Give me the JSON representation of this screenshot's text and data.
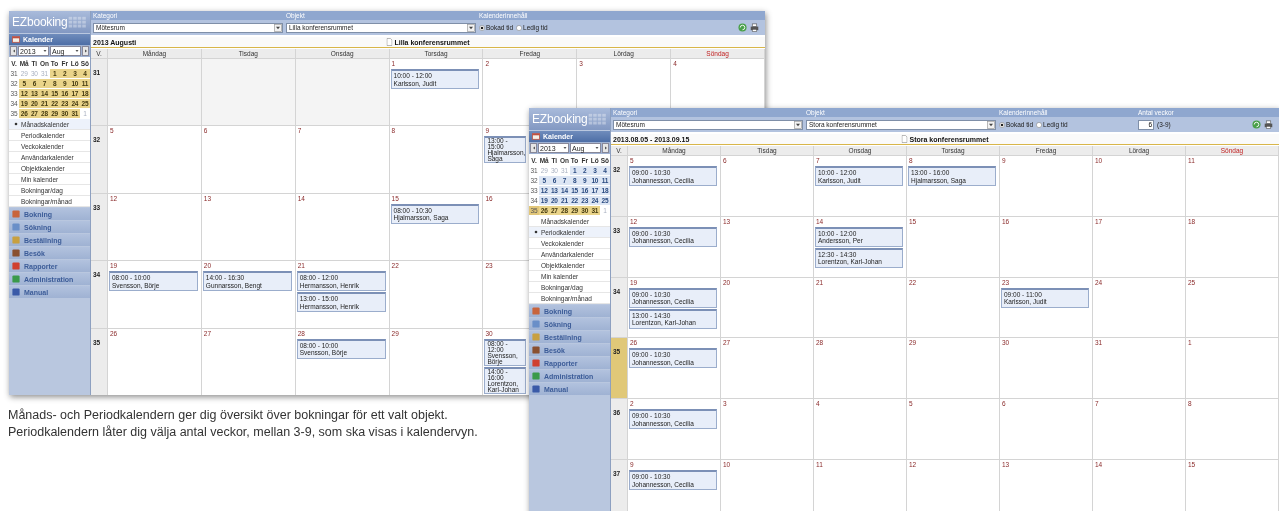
{
  "windows": [
    {
      "sidebar": {
        "logo": "EZbooking",
        "section": "Kalender",
        "year": "2013",
        "month": "Aug",
        "mini_calendar": {
          "headers": [
            "V.",
            "Må",
            "Ti",
            "On",
            "To",
            "Fr",
            "Lö",
            "Sö"
          ],
          "weeks": [
            {
              "week": "31",
              "current": false,
              "days": [
                {
                  "day": "29",
                  "kind": "other"
                },
                {
                  "day": "30",
                  "kind": "other"
                },
                {
                  "day": "31",
                  "kind": "other"
                },
                {
                  "day": "1",
                  "kind": "highlight"
                },
                {
                  "day": "2",
                  "kind": "highlight"
                },
                {
                  "day": "3",
                  "kind": "highlight"
                },
                {
                  "day": "4",
                  "kind": "highlight"
                }
              ]
            },
            {
              "week": "32",
              "current": false,
              "days": [
                {
                  "day": "5",
                  "kind": "highlight"
                },
                {
                  "day": "6",
                  "kind": "highlight"
                },
                {
                  "day": "7",
                  "kind": "highlight"
                },
                {
                  "day": "8",
                  "kind": "highlight"
                },
                {
                  "day": "9",
                  "kind": "highlight"
                },
                {
                  "day": "10",
                  "kind": "highlight"
                },
                {
                  "day": "11",
                  "kind": "highlight"
                }
              ]
            },
            {
              "week": "33",
              "current": false,
              "days": [
                {
                  "day": "12",
                  "kind": "highlight"
                },
                {
                  "day": "13",
                  "kind": "highlight"
                },
                {
                  "day": "14",
                  "kind": "highlight"
                },
                {
                  "day": "15",
                  "kind": "highlight"
                },
                {
                  "day": "16",
                  "kind": "highlight"
                },
                {
                  "day": "17",
                  "kind": "highlight"
                },
                {
                  "day": "18",
                  "kind": "highlight"
                }
              ]
            },
            {
              "week": "34",
              "current": false,
              "days": [
                {
                  "day": "19",
                  "kind": "highlight"
                },
                {
                  "day": "20",
                  "kind": "highlight"
                },
                {
                  "day": "21",
                  "kind": "highlight"
                },
                {
                  "day": "22",
                  "kind": "highlight"
                },
                {
                  "day": "23",
                  "kind": "highlight"
                },
                {
                  "day": "24",
                  "kind": "highlight"
                },
                {
                  "day": "25",
                  "kind": "highlight"
                }
              ]
            },
            {
              "week": "35",
              "current": false,
              "days": [
                {
                  "day": "26",
                  "kind": "highlight"
                },
                {
                  "day": "27",
                  "kind": "highlight"
                },
                {
                  "day": "28",
                  "kind": "highlight"
                },
                {
                  "day": "29",
                  "kind": "highlight"
                },
                {
                  "day": "30",
                  "kind": "highlight"
                },
                {
                  "day": "31",
                  "kind": "highlight"
                },
                {
                  "day": "1",
                  "kind": "other"
                }
              ]
            }
          ]
        },
        "views": [
          {
            "label": "Månadskalender",
            "selected": true
          },
          {
            "label": "Periodkalender",
            "selected": false
          },
          {
            "label": "Veckokalender",
            "selected": false
          },
          {
            "label": "Användarkalender",
            "selected": false
          },
          {
            "label": "Objektkalender",
            "selected": false
          },
          {
            "label": "Min kalender",
            "selected": false
          },
          {
            "label": "Bokningar/dag",
            "selected": false
          },
          {
            "label": "Bokningar/månad",
            "selected": false
          }
        ],
        "menu": [
          "Bokning",
          "Sökning",
          "Beställning",
          "Besök",
          "Rapporter",
          "Administration",
          "Manual"
        ]
      },
      "filters": [
        {
          "kind": "select",
          "label": "Kategori",
          "value": "Mötesrum"
        },
        {
          "kind": "select",
          "label": "Objekt",
          "value": "Lilla konferensrummet"
        },
        {
          "kind": "radio",
          "label": "Kalenderinnehåll",
          "options": [
            {
              "label": "Bokad tid",
              "selected": true
            },
            {
              "label": "Ledig tid",
              "selected": false
            }
          ]
        }
      ],
      "period": "2013 Augusti",
      "object": "Lilla konferensrummet",
      "day_headers": [
        {
          "label": "V.",
          "holiday": false
        },
        {
          "label": "Måndag",
          "holiday": false
        },
        {
          "label": "Tisdag",
          "holiday": false
        },
        {
          "label": "Onsdag",
          "holiday": false
        },
        {
          "label": "Torsdag",
          "holiday": false
        },
        {
          "label": "Fredag",
          "holiday": false
        },
        {
          "label": "Lördag",
          "holiday": false
        },
        {
          "label": "Söndag",
          "holiday": true
        }
      ],
      "weeks": [
        {
          "week": "31",
          "current": false,
          "days": [
            {
              "kind": "blank"
            },
            {
              "kind": "blank"
            },
            {
              "kind": "blank"
            },
            {
              "kind": "day",
              "date": "1",
              "events": [
                {
                  "time": "10:00 - 12:00",
                  "name": "Karlsson, Judit"
                }
              ]
            },
            {
              "kind": "day",
              "date": "2"
            },
            {
              "kind": "day",
              "date": "3"
            },
            {
              "kind": "day",
              "date": "4"
            }
          ]
        },
        {
          "week": "32",
          "current": false,
          "days": [
            {
              "kind": "day",
              "date": "5"
            },
            {
              "kind": "day",
              "date": "6"
            },
            {
              "kind": "day",
              "date": "7"
            },
            {
              "kind": "day",
              "date": "8"
            },
            {
              "kind": "day",
              "date": "9",
              "events": [
                {
                  "time": "13:00 - 15:00",
                  "name": "Hjalmarsson, Saga"
                }
              ]
            }
          ]
        },
        {
          "week": "33",
          "current": false,
          "days": [
            {
              "kind": "day",
              "date": "12"
            },
            {
              "kind": "day",
              "date": "13"
            },
            {
              "kind": "day",
              "date": "14"
            },
            {
              "kind": "day",
              "date": "15",
              "events": [
                {
                  "time": "08:00 - 10:30",
                  "name": "Hjalmarsson, Saga"
                }
              ]
            },
            {
              "kind": "day",
              "date": "16"
            }
          ]
        },
        {
          "week": "34",
          "current": false,
          "days": [
            {
              "kind": "day",
              "date": "19",
              "events": [
                {
                  "time": "08:00 - 10:00",
                  "name": "Svensson, Börje"
                }
              ]
            },
            {
              "kind": "day",
              "date": "20",
              "events": [
                {
                  "time": "14:00 - 16:30",
                  "name": "Gunnarsson, Bengt"
                }
              ]
            },
            {
              "kind": "day",
              "date": "21",
              "events": [
                {
                  "time": "08:00 - 12:00",
                  "name": "Hermansson, Henrik"
                },
                {
                  "time": "13:00 - 15:00",
                  "name": "Hermansson, Henrik"
                }
              ]
            },
            {
              "kind": "day",
              "date": "22"
            },
            {
              "kind": "day",
              "date": "23"
            }
          ]
        },
        {
          "week": "35",
          "current": false,
          "days": [
            {
              "kind": "day",
              "date": "26"
            },
            {
              "kind": "day",
              "date": "27"
            },
            {
              "kind": "day",
              "date": "28",
              "events": [
                {
                  "time": "08:00 - 10:00",
                  "name": "Svensson, Börje"
                }
              ]
            },
            {
              "kind": "day",
              "date": "29"
            },
            {
              "kind": "day",
              "date": "30",
              "events": [
                {
                  "time": "08:00 - 12:00",
                  "name": "Svensson, Börje"
                },
                {
                  "time": "14:00 - 16:00",
                  "name": "Lorentzon, Karl-Johan"
                }
              ]
            }
          ]
        }
      ]
    },
    {
      "sidebar": {
        "logo": "EZbooking",
        "section": "Kalender",
        "year": "2013",
        "month": "Aug",
        "mini_calendar": {
          "headers": [
            "V.",
            "Må",
            "Ti",
            "On",
            "To",
            "Fr",
            "Lö",
            "Sö"
          ],
          "weeks": [
            {
              "week": "31",
              "current": false,
              "days": [
                {
                  "day": "29",
                  "kind": "other"
                },
                {
                  "day": "30",
                  "kind": "other"
                },
                {
                  "day": "31",
                  "kind": "other"
                },
                {
                  "day": "1",
                  "kind": "normal"
                },
                {
                  "day": "2",
                  "kind": "normal"
                },
                {
                  "day": "3",
                  "kind": "normal"
                },
                {
                  "day": "4",
                  "kind": "normal"
                }
              ]
            },
            {
              "week": "32",
              "current": false,
              "days": [
                {
                  "day": "5",
                  "kind": "normal"
                },
                {
                  "day": "6",
                  "kind": "normal"
                },
                {
                  "day": "7",
                  "kind": "normal"
                },
                {
                  "day": "8",
                  "kind": "normal"
                },
                {
                  "day": "9",
                  "kind": "normal"
                },
                {
                  "day": "10",
                  "kind": "normal"
                },
                {
                  "day": "11",
                  "kind": "normal"
                }
              ]
            },
            {
              "week": "33",
              "current": false,
              "days": [
                {
                  "day": "12",
                  "kind": "normal"
                },
                {
                  "day": "13",
                  "kind": "normal"
                },
                {
                  "day": "14",
                  "kind": "normal"
                },
                {
                  "day": "15",
                  "kind": "normal"
                },
                {
                  "day": "16",
                  "kind": "normal"
                },
                {
                  "day": "17",
                  "kind": "normal"
                },
                {
                  "day": "18",
                  "kind": "normal"
                }
              ]
            },
            {
              "week": "34",
              "current": false,
              "days": [
                {
                  "day": "19",
                  "kind": "normal"
                },
                {
                  "day": "20",
                  "kind": "normal"
                },
                {
                  "day": "21",
                  "kind": "normal"
                },
                {
                  "day": "22",
                  "kind": "normal"
                },
                {
                  "day": "23",
                  "kind": "normal"
                },
                {
                  "day": "24",
                  "kind": "normal"
                },
                {
                  "day": "25",
                  "kind": "normal"
                }
              ]
            },
            {
              "week": "35",
              "current": true,
              "days": [
                {
                  "day": "26",
                  "kind": "highlight"
                },
                {
                  "day": "27",
                  "kind": "highlight"
                },
                {
                  "day": "28",
                  "kind": "highlight"
                },
                {
                  "day": "29",
                  "kind": "highlight"
                },
                {
                  "day": "30",
                  "kind": "highlight"
                },
                {
                  "day": "31",
                  "kind": "highlight"
                },
                {
                  "day": "1",
                  "kind": "other"
                }
              ]
            }
          ]
        },
        "views": [
          {
            "label": "Månadskalender",
            "selected": false
          },
          {
            "label": "Periodkalender",
            "selected": true
          },
          {
            "label": "Veckokalender",
            "selected": false
          },
          {
            "label": "Användarkalender",
            "selected": false
          },
          {
            "label": "Objektkalender",
            "selected": false
          },
          {
            "label": "Min kalender",
            "selected": false
          },
          {
            "label": "Bokningar/dag",
            "selected": false
          },
          {
            "label": "Bokningar/månad",
            "selected": false
          }
        ],
        "menu": [
          "Bokning",
          "Sökning",
          "Beställning",
          "Besök",
          "Rapporter",
          "Administration",
          "Manual"
        ]
      },
      "filters": [
        {
          "kind": "select",
          "label": "Kategori",
          "value": "Mötesrum"
        },
        {
          "kind": "select",
          "label": "Objekt",
          "value": "Stora konferensrummet"
        },
        {
          "kind": "radio",
          "label": "Kalenderinnehåll",
          "options": [
            {
              "label": "Bokad tid",
              "selected": true
            },
            {
              "label": "Ledig tid",
              "selected": false
            }
          ]
        },
        {
          "kind": "number",
          "label": "Antal veckor",
          "value": "6",
          "hint": "(3-9)"
        }
      ],
      "period": "2013.08.05 - 2013.09.15",
      "object": "Stora konferensrummet",
      "day_headers": [
        {
          "label": "V.",
          "holiday": false
        },
        {
          "label": "Måndag",
          "holiday": false
        },
        {
          "label": "Tisdag",
          "holiday": false
        },
        {
          "label": "Onsdag",
          "holiday": false
        },
        {
          "label": "Torsdag",
          "holiday": false
        },
        {
          "label": "Fredag",
          "holiday": false
        },
        {
          "label": "Lördag",
          "holiday": false
        },
        {
          "label": "Söndag",
          "holiday": true
        }
      ],
      "weeks": [
        {
          "week": "32",
          "current": false,
          "days": [
            {
              "kind": "day",
              "date": "5",
              "events": [
                {
                  "time": "09:00 - 10:30",
                  "name": "Johannesson, Cecilia"
                }
              ]
            },
            {
              "kind": "day",
              "date": "6"
            },
            {
              "kind": "day",
              "date": "7",
              "events": [
                {
                  "time": "10:00 - 12:00",
                  "name": "Karlsson, Judit"
                }
              ]
            },
            {
              "kind": "day",
              "date": "8",
              "events": [
                {
                  "time": "13:00 - 16:00",
                  "name": "Hjalmarsson, Saga"
                }
              ]
            },
            {
              "kind": "day",
              "date": "9"
            },
            {
              "kind": "day",
              "date": "10"
            },
            {
              "kind": "day",
              "date": "11"
            }
          ]
        },
        {
          "week": "33",
          "current": false,
          "days": [
            {
              "kind": "day",
              "date": "12",
              "events": [
                {
                  "time": "09:00 - 10:30",
                  "name": "Johannesson, Cecilia"
                }
              ]
            },
            {
              "kind": "day",
              "date": "13"
            },
            {
              "kind": "day",
              "date": "14",
              "events": [
                {
                  "time": "10:00 - 12:00",
                  "name": "Andersson, Per"
                },
                {
                  "time": "12:30 - 14:30",
                  "name": "Lorentzon, Karl-Johan"
                }
              ]
            },
            {
              "kind": "day",
              "date": "15"
            },
            {
              "kind": "day",
              "date": "16"
            },
            {
              "kind": "day",
              "date": "17"
            },
            {
              "kind": "day",
              "date": "18"
            }
          ]
        },
        {
          "week": "34",
          "current": false,
          "days": [
            {
              "kind": "day",
              "date": "19",
              "events": [
                {
                  "time": "09:00 - 10:30",
                  "name": "Johannesson, Cecilia"
                },
                {
                  "time": "13:00 - 14:30",
                  "name": "Lorentzon, Karl-Johan"
                }
              ]
            },
            {
              "kind": "day",
              "date": "20"
            },
            {
              "kind": "day",
              "date": "21"
            },
            {
              "kind": "day",
              "date": "22"
            },
            {
              "kind": "day",
              "date": "23",
              "events": [
                {
                  "time": "09:00 - 11:00",
                  "name": "Karlsson, Judit"
                }
              ]
            },
            {
              "kind": "day",
              "date": "24"
            },
            {
              "kind": "day",
              "date": "25"
            }
          ]
        },
        {
          "week": "35",
          "current": true,
          "days": [
            {
              "kind": "day",
              "date": "26",
              "events": [
                {
                  "time": "09:00 - 10:30",
                  "name": "Johannesson, Cecilia"
                }
              ]
            },
            {
              "kind": "day",
              "date": "27"
            },
            {
              "kind": "day",
              "date": "28"
            },
            {
              "kind": "day",
              "date": "29"
            },
            {
              "kind": "day",
              "date": "30"
            },
            {
              "kind": "day",
              "date": "31"
            },
            {
              "kind": "day",
              "date": "1"
            }
          ]
        },
        {
          "week": "36",
          "current": false,
          "days": [
            {
              "kind": "day",
              "date": "2",
              "events": [
                {
                  "time": "09:00 - 10:30",
                  "name": "Johannesson, Cecilia"
                }
              ]
            },
            {
              "kind": "day",
              "date": "3"
            },
            {
              "kind": "day",
              "date": "4"
            },
            {
              "kind": "day",
              "date": "5"
            },
            {
              "kind": "day",
              "date": "6"
            },
            {
              "kind": "day",
              "date": "7"
            },
            {
              "kind": "day",
              "date": "8"
            }
          ]
        },
        {
          "week": "37",
          "current": false,
          "days": [
            {
              "kind": "day",
              "date": "9",
              "events": [
                {
                  "time": "09:00 - 10:30",
                  "name": "Johannesson, Cecilia"
                }
              ]
            },
            {
              "kind": "day",
              "date": "10"
            },
            {
              "kind": "day",
              "date": "11"
            },
            {
              "kind": "day",
              "date": "12"
            },
            {
              "kind": "day",
              "date": "13"
            },
            {
              "kind": "day",
              "date": "14"
            },
            {
              "kind": "day",
              "date": "15"
            }
          ]
        }
      ]
    }
  ],
  "caption": "Månads- och Periodkalendern ger dig översikt över bokningar för ett valt objekt. Periodkalendern låter dig välja antal veckor, mellan 3-9, som ska visas i kalendervyn."
}
